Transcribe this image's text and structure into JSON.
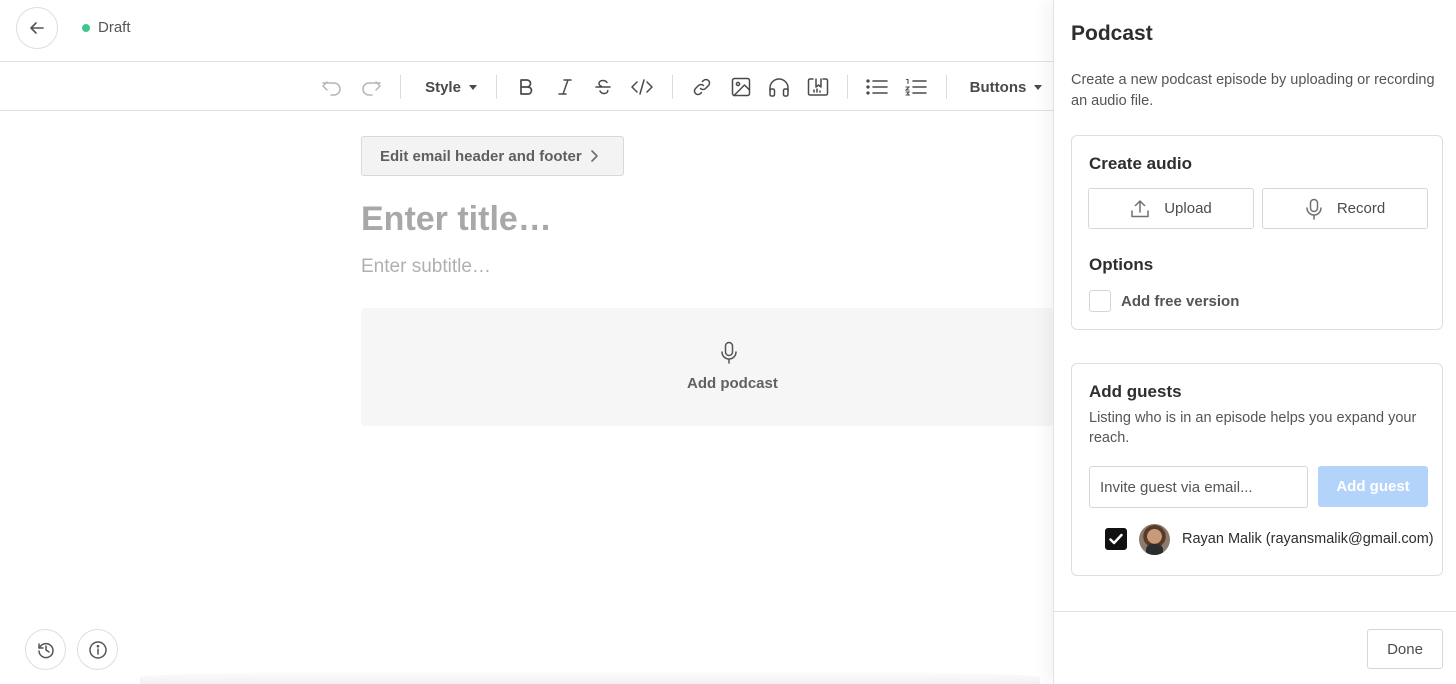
{
  "header": {
    "status": "Draft"
  },
  "toolbar": {
    "style_label": "Style",
    "buttons_label": "Buttons",
    "icons": [
      "undo-icon",
      "redo-icon",
      "bold-icon",
      "italic-icon",
      "strikethrough-icon",
      "code-icon",
      "link-icon",
      "image-icon",
      "audio-icon",
      "video-icon",
      "bullet-list-icon",
      "numbered-list-icon"
    ]
  },
  "editor": {
    "edit_header_label": "Edit email header and footer",
    "title_placeholder": "Enter title…",
    "subtitle_placeholder": "Enter subtitle…",
    "add_podcast_label": "Add podcast"
  },
  "panel": {
    "title": "Podcast",
    "description": "Create a new podcast episode by uploading or recording an audio file.",
    "create_audio": {
      "heading": "Create audio",
      "upload_label": "Upload",
      "record_label": "Record"
    },
    "options": {
      "heading": "Options",
      "free_version_label": "Add free version",
      "free_version_checked": false
    },
    "guests": {
      "heading": "Add guests",
      "description": "Listing who is in an episode helps you expand your reach.",
      "email_placeholder": "Invite guest via email...",
      "add_button_label": "Add guest",
      "list": [
        {
          "name": "Rayan Malik (rayansmalik@gmail.com)",
          "checked": true
        }
      ]
    },
    "done_label": "Done"
  },
  "colors": {
    "status_dot": "#3ec78c",
    "add_guest_disabled": "#b3d3fb"
  }
}
